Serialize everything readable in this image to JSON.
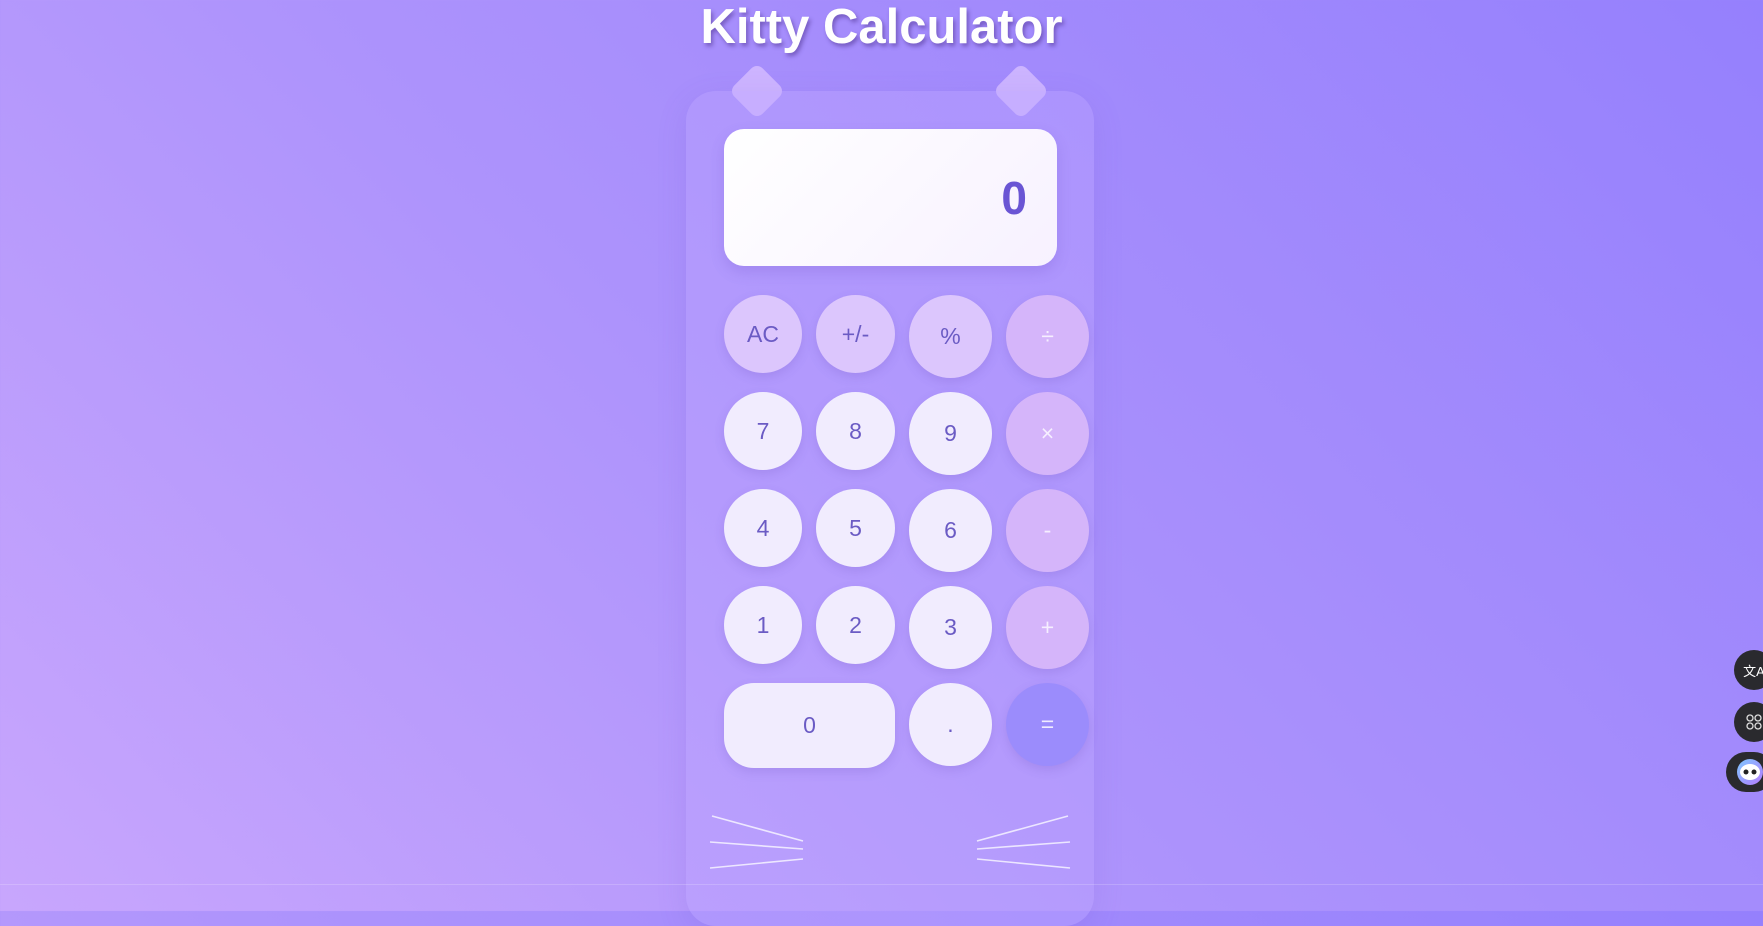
{
  "page": {
    "title": "Kitty Calculator"
  },
  "display": {
    "value": "0"
  },
  "buttons": {
    "ac": "AC",
    "sign": "+/-",
    "percent": "%",
    "divide": "÷",
    "seven": "7",
    "eight": "8",
    "nine": "9",
    "multiply": "×",
    "four": "4",
    "five": "5",
    "six": "6",
    "subtract": "-",
    "one": "1",
    "two": "2",
    "three": "3",
    "add": "+",
    "zero": "0",
    "decimal": ".",
    "equals": "="
  },
  "side_tools": {
    "translate_icon": "文A",
    "apps_icon": "88",
    "assistant_icon": "••"
  },
  "colors": {
    "accent": "#6a55d4",
    "operator": "#d5b5fa",
    "equals": "#9b8cfc"
  }
}
